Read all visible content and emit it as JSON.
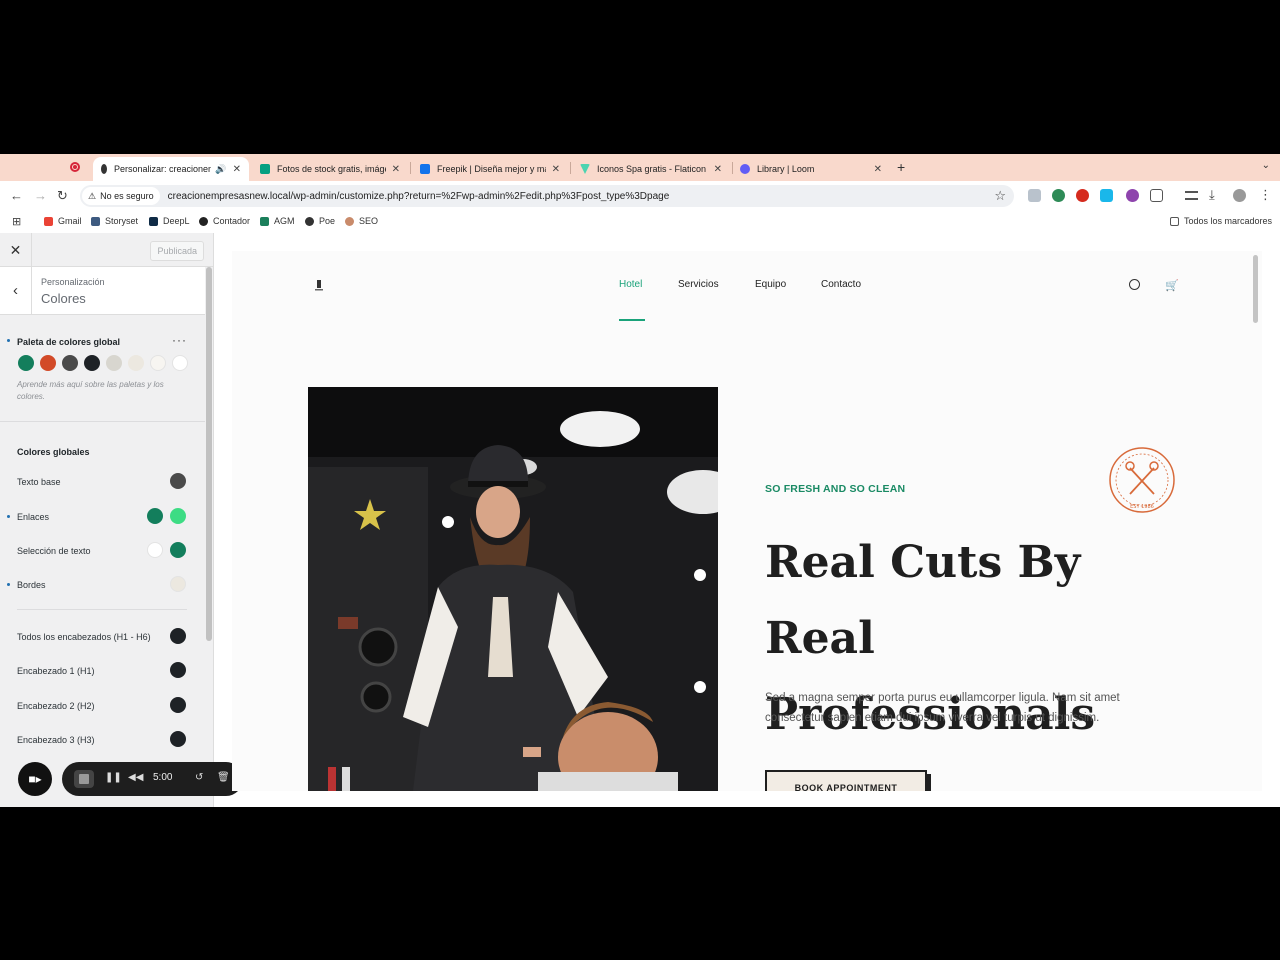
{
  "browser": {
    "tabs": [
      {
        "title": "Personalizar: creacionem",
        "favicon_color": "#333333",
        "active": true,
        "audio": "🔊"
      },
      {
        "title": "Fotos de stock gratis, imágen",
        "favicon_color": "#05a081"
      },
      {
        "title": "Freepik | Diseña mejor y más",
        "favicon_color": "#1273eb"
      },
      {
        "title": "Iconos Spa gratis - Flaticon",
        "favicon_color": "#4cd4b0"
      },
      {
        "title": "Library | Loom",
        "favicon_color": "#625df5"
      }
    ],
    "security_label": "No es seguro",
    "url": "creacionempresasnew.local/wp-admin/customize.php?return=%2Fwp-admin%2Fedit.php%3Fpost_type%3Dpage",
    "bookmarks": [
      "Gmail",
      "Storyset",
      "DeepL",
      "Contador",
      "AGM",
      "Poe",
      "SEO"
    ],
    "all_bookmarks": "Todos los marcadores"
  },
  "customizer": {
    "published_label": "Publicada",
    "breadcrumb": "Personalización",
    "section_title": "Colores",
    "global_palette_title": "Paleta de colores global",
    "palette": [
      "#137e5c",
      "#d24a28",
      "#4a4a4a",
      "#1e2226",
      "#d8d6cf",
      "#ece8e0",
      "#f7f5f1",
      "#ffffff"
    ],
    "palette_help": "Aprende más aquí sobre las paletas y los colores.",
    "global_colors_title": "Colores globales",
    "rows": [
      {
        "label": "Texto base",
        "colors": [
          "#4a4a4a"
        ]
      },
      {
        "label": "Enlaces",
        "colors": [
          "#137e5c",
          "#3ddc84"
        ]
      },
      {
        "label": "Selección de texto",
        "colors": [
          "#ffffff",
          "#137e5c"
        ]
      },
      {
        "label": "Bordes",
        "colors": [
          "#ece8e0"
        ]
      },
      {
        "label": "Todos los encabezados (H1 - H6)",
        "colors": [
          "#1e2226"
        ]
      },
      {
        "label": "Encabezado 1 (H1)",
        "colors": [
          "#1e2226"
        ]
      },
      {
        "label": "Encabezado 2 (H2)",
        "colors": [
          "#1e2226"
        ]
      },
      {
        "label": "Encabezado 3 (H3)",
        "colors": [
          "#1e2226"
        ]
      }
    ]
  },
  "loom": {
    "timer": "5:00"
  },
  "site": {
    "nav": [
      "Hotel",
      "Servicios",
      "Equipo",
      "Contacto"
    ],
    "eyebrow": "SO FRESH AND SO CLEAN",
    "headline": "Real Cuts By Real Professionals",
    "body": "Sed a magna semper porta purus eu ullamcorper ligula. Nam sit amet consectetur sapien etiam dui ipsum viverra vel turpis ut dignissim.",
    "cta": "BOOK APPOINTMENT",
    "stamp_text": "EST 1986",
    "accent": "#1aa37a",
    "stamp_color": "#d86a3a"
  }
}
